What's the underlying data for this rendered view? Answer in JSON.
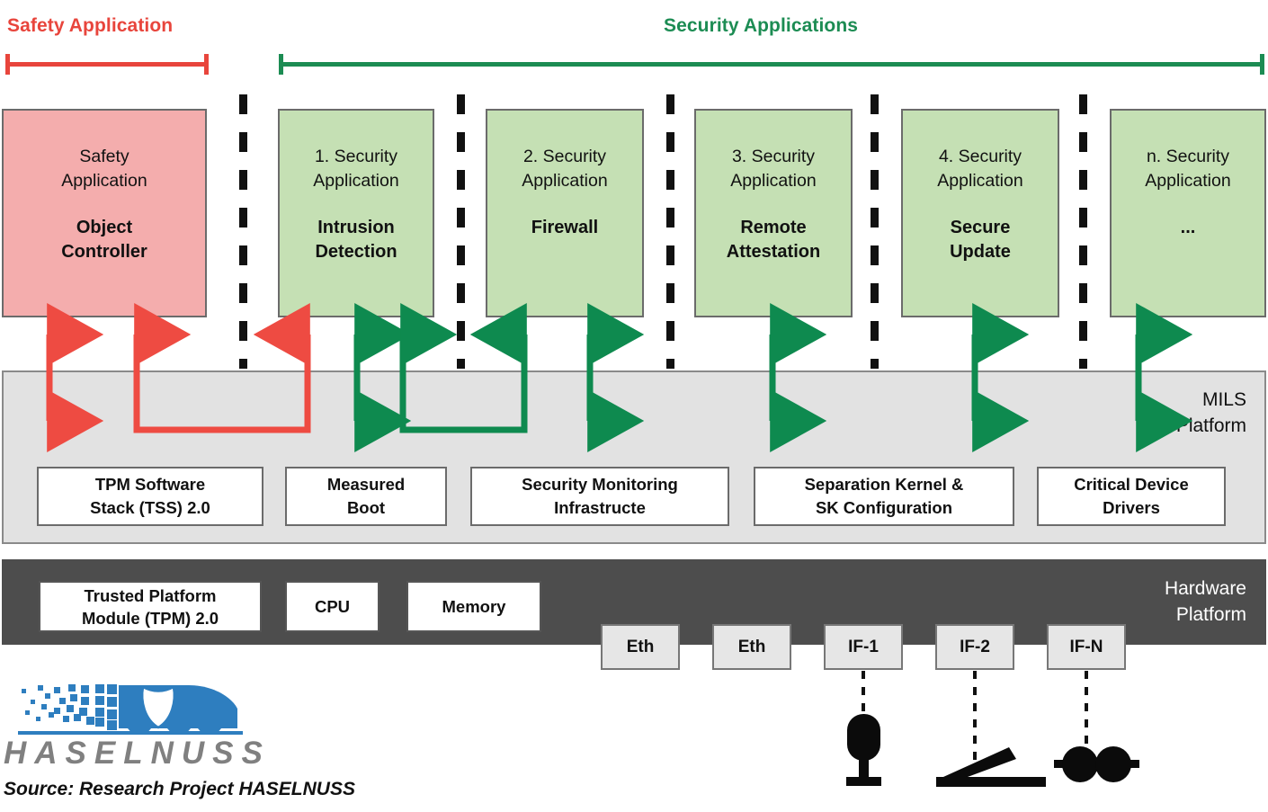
{
  "groups": {
    "safety": {
      "title": "Safety Application",
      "color": "#E8453C"
    },
    "security": {
      "title": "Security Applications",
      "color": "#1C8C53"
    }
  },
  "applications": [
    {
      "kind": "Safety\nApplication",
      "name": "Object\nController",
      "variant": "safety"
    },
    {
      "kind": "1. Security\nApplication",
      "name": "Intrusion\nDetection",
      "variant": "security"
    },
    {
      "kind": "2. Security\nApplication",
      "name": "Firewall",
      "variant": "security"
    },
    {
      "kind": "3. Security\nApplication",
      "name": "Remote\nAttestation",
      "variant": "security"
    },
    {
      "kind": "4. Security\nApplication",
      "name": "Secure\nUpdate",
      "variant": "security"
    },
    {
      "kind": "n. Security\nApplication",
      "name": "...",
      "variant": "security"
    }
  ],
  "mils": {
    "label": "MILS\nPlatform",
    "components": [
      {
        "label": "TPM Software\nStack (TSS) 2.0"
      },
      {
        "label": "Measured\nBoot"
      },
      {
        "label": "Security Monitoring\nInfrastructe"
      },
      {
        "label": "Separation Kernel &\nSK Configuration"
      },
      {
        "label": "Critical Device\nDrivers"
      }
    ]
  },
  "hardware": {
    "label": "Hardware\nPlatform",
    "components": [
      {
        "label": "Trusted Platform\nModule (TPM) 2.0"
      },
      {
        "label": "CPU"
      },
      {
        "label": "Memory"
      }
    ],
    "interfaces": [
      {
        "label": "Eth"
      },
      {
        "label": "Eth"
      },
      {
        "label": "IF-1"
      },
      {
        "label": "IF-2"
      },
      {
        "label": "IF-N"
      }
    ],
    "field_devices": [
      {
        "icon": "railway-signal-icon"
      },
      {
        "icon": "point-machine-icon"
      },
      {
        "icon": "axle-counter-icon"
      }
    ]
  },
  "footer": {
    "logo_wordmark": "HASELNUSS",
    "source": "Source: Research Project HASELNUSS",
    "logo_color": "#2E7EBF"
  },
  "colors": {
    "safety_red": "#E8453C",
    "security_green": "#1C8C53",
    "safety_box": "#F4ADAD",
    "security_box": "#C5E0B4",
    "mils_bg": "#E2E2E2",
    "hardware_bg": "#4D4D4D"
  }
}
